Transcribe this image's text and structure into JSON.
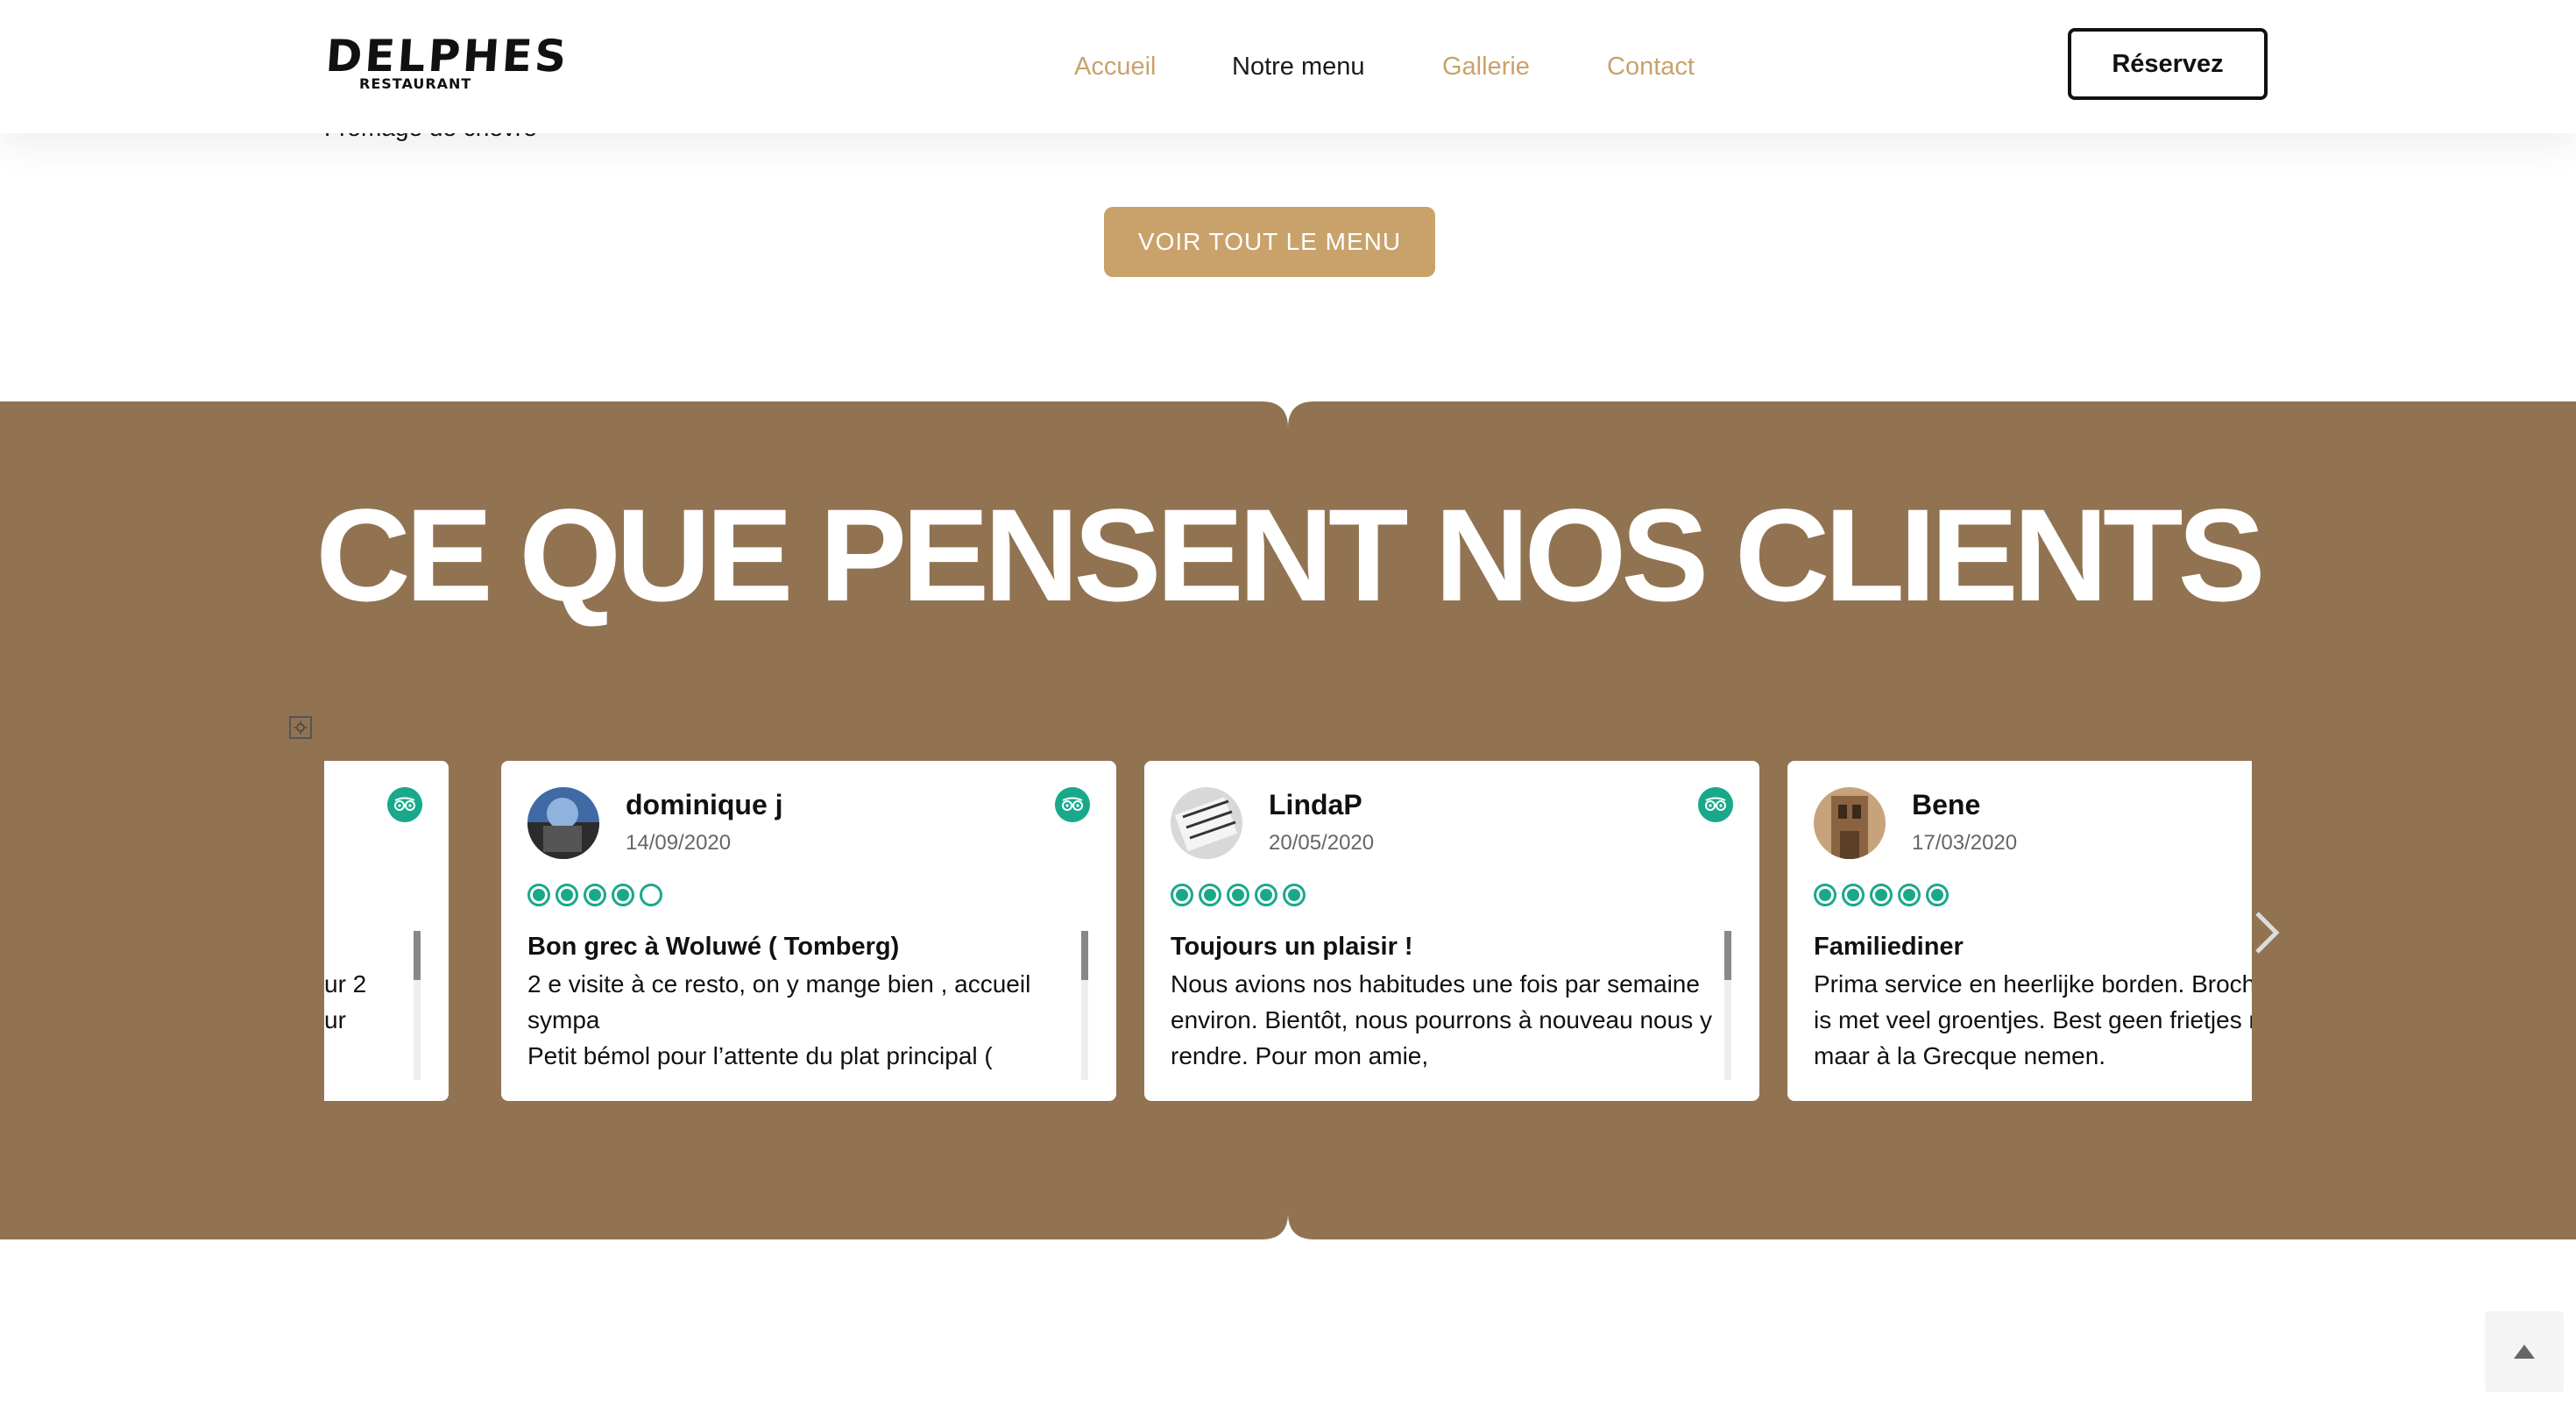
{
  "header": {
    "logo_main": "DELPHES",
    "logo_sub": "RESTAURANT",
    "nav": [
      {
        "label": "Accueil",
        "active": false
      },
      {
        "label": "Notre menu",
        "active": true
      },
      {
        "label": "Gallerie",
        "active": false
      },
      {
        "label": "Contact",
        "active": false
      }
    ],
    "reserve_label": "Réservez"
  },
  "menu_preview": {
    "partial_item": "Fromage de chèvre",
    "see_all_label": "VOIR TOUT LE MENU"
  },
  "reviews": {
    "title": "CE QUE PENSENT NOS CLIENTS",
    "partial_card_text": "ur 2\nur",
    "cards": [
      {
        "name": "dominique j",
        "date": "14/09/2020",
        "rating": 4,
        "title": "Bon grec à Woluwé ( Tomberg)",
        "body": "2 e visite à ce resto, on y mange bien , accueil sympa\nPetit bémol pour l’attente du plat principal ("
      },
      {
        "name": "LindaP",
        "date": "20/05/2020",
        "rating": 5,
        "title": "Toujours un plaisir !",
        "body": "Nous avions nos habitudes une fois par semaine environ. Bientôt, nous pourrons à nouveau nous y rendre. Pour mon amie,"
      },
      {
        "name": "Bene",
        "date": "17/03/2020",
        "rating": 5,
        "title": "Familiediner",
        "body": "Prima service en heerlijke borden. Brochette lam is met veel groentjes. Best geen frietjes nemen maar à la Grecque nemen."
      }
    ],
    "icon_names": [
      "tripadvisor-icon",
      "settings-icon",
      "chevron-right-icon",
      "chevron-up-icon"
    ]
  },
  "colors": {
    "accent_gold": "#c9a26b",
    "band_brown": "#917352",
    "tripadvisor_green": "#19a98a"
  }
}
